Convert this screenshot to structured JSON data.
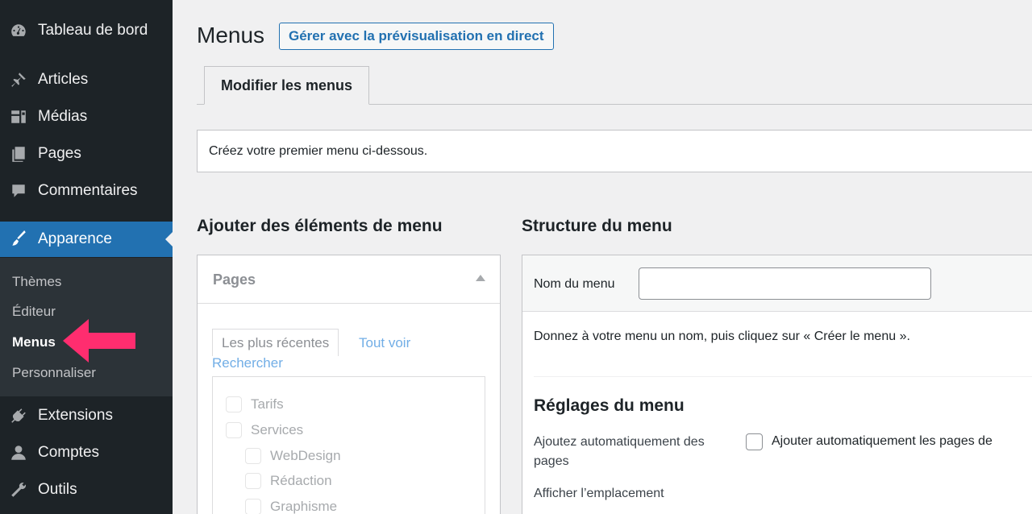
{
  "sidebar": {
    "items": [
      {
        "label": "Tableau de bord",
        "icon": "dashboard-icon"
      },
      {
        "label": "Articles",
        "icon": "pin-icon"
      },
      {
        "label": "Médias",
        "icon": "media-icon"
      },
      {
        "label": "Pages",
        "icon": "pages-icon"
      },
      {
        "label": "Commentaires",
        "icon": "comment-icon"
      },
      {
        "label": "Apparence",
        "icon": "paintbrush-icon",
        "active": true
      },
      {
        "label": "Extensions",
        "icon": "plugin-icon"
      },
      {
        "label": "Comptes",
        "icon": "user-icon"
      },
      {
        "label": "Outils",
        "icon": "wrench-icon"
      }
    ],
    "submenu": [
      "Thèmes",
      "Éditeur",
      "Menus",
      "Personnaliser"
    ],
    "current_sub": "Menus",
    "accent": "#2271b1",
    "bg": "#1d2327",
    "arrow_color": "#ff2d6f"
  },
  "header": {
    "title": "Menus",
    "live_preview_button": "Gérer avec la prévisualisation en direct"
  },
  "tabs": [
    {
      "label": "Modifier les menus",
      "active": true
    }
  ],
  "notice": "Créez votre premier menu ci-dessous.",
  "add_items": {
    "heading": "Ajouter des éléments de menu",
    "box_title": "Pages",
    "tabs": [
      "Les plus récentes",
      "Tout voir",
      "Rechercher"
    ],
    "pages": [
      {
        "label": "Tarifs",
        "level": 0
      },
      {
        "label": "Services",
        "level": 0
      },
      {
        "label": "WebDesign",
        "level": 1
      },
      {
        "label": "Rédaction",
        "level": 1
      },
      {
        "label": "Graphisme",
        "level": 1
      }
    ]
  },
  "structure": {
    "heading": "Structure du menu",
    "name_label": "Nom du menu",
    "name_value": "",
    "hint": "Donnez à votre menu un nom, puis cliquez sur « Créer le menu ».",
    "settings_title": "Réglages du menu",
    "auto_add_label": "Ajoutez automatiquement des pages",
    "auto_add_option": "Ajouter automatiquement les pages de",
    "location_label": "Afficher l’emplacement"
  }
}
